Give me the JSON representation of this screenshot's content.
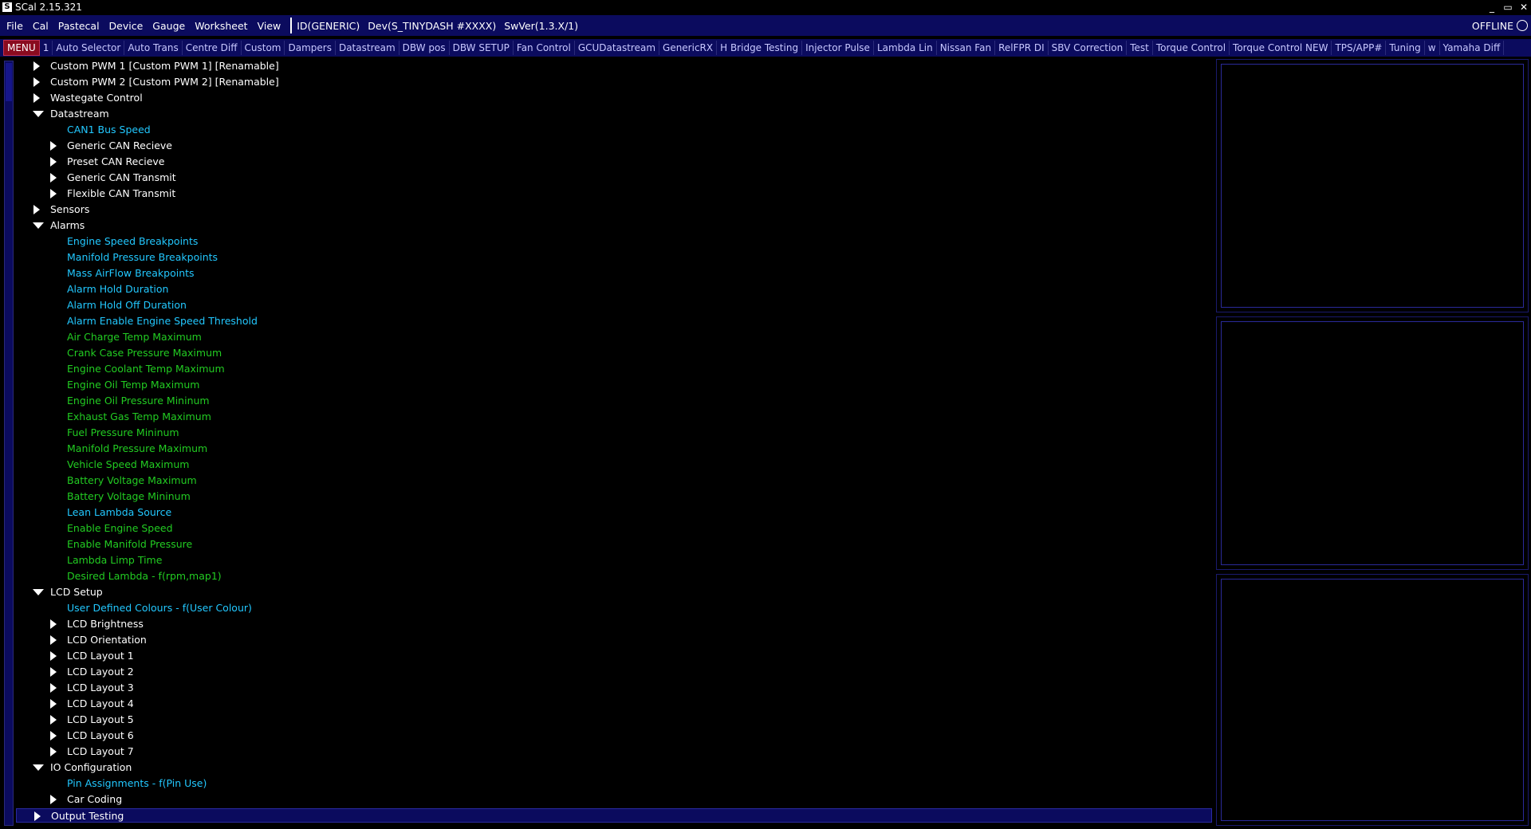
{
  "window": {
    "title": "SCal 2.15.321",
    "icon_letter": "S",
    "controls": [
      "_",
      "▭",
      "✕"
    ]
  },
  "menubar": {
    "items": [
      "File",
      "Cal",
      "Pastecal",
      "Device",
      "Gauge",
      "Worksheet",
      "View"
    ],
    "device_info": [
      "ID(GENERIC)",
      "Dev(S_TINYDASH #XXXX)",
      "SwVer(1.3.X/1)"
    ],
    "status": "OFFLINE"
  },
  "tabs": [
    "MENU",
    "1",
    "Auto Selector",
    "Auto Trans",
    "Centre Diff",
    "Custom",
    "Dampers",
    "Datastream",
    "DBW pos",
    "DBW SETUP",
    "Fan Control",
    "GCUDatastream",
    "GenericRX",
    "H Bridge Testing",
    "Injector Pulse",
    "Lambda Lin",
    "Nissan Fan",
    "RelFPR DI",
    "SBV Correction",
    "Test",
    "Torque Control",
    "Torque Control NEW",
    "TPS/APP#",
    "Tuning",
    "w",
    "Yamaha Diff"
  ],
  "tree": [
    {
      "label": "Custom PWM 1 [Custom PWM 1] [Renamable]",
      "level": 1,
      "expander": "right",
      "color": "white"
    },
    {
      "label": "Custom PWM 2 [Custom PWM 2] [Renamable]",
      "level": 1,
      "expander": "right",
      "color": "white"
    },
    {
      "label": "Wastegate Control",
      "level": 1,
      "expander": "right",
      "color": "white"
    },
    {
      "label": "Datastream",
      "level": 1,
      "expander": "down",
      "color": "white"
    },
    {
      "label": "CAN1 Bus Speed",
      "level": 2,
      "expander": "none",
      "color": "cyan"
    },
    {
      "label": "Generic CAN Recieve",
      "level": 2,
      "expander": "right",
      "color": "white"
    },
    {
      "label": "Preset CAN Recieve",
      "level": 2,
      "expander": "right",
      "color": "white"
    },
    {
      "label": "Generic CAN Transmit",
      "level": 2,
      "expander": "right",
      "color": "white"
    },
    {
      "label": "Flexible CAN Transmit",
      "level": 2,
      "expander": "right",
      "color": "white"
    },
    {
      "label": "Sensors",
      "level": 1,
      "expander": "right",
      "color": "white"
    },
    {
      "label": "Alarms",
      "level": 1,
      "expander": "down",
      "color": "white"
    },
    {
      "label": "Engine Speed Breakpoints",
      "level": 2,
      "expander": "none",
      "color": "cyan"
    },
    {
      "label": "Manifold Pressure Breakpoints",
      "level": 2,
      "expander": "none",
      "color": "cyan"
    },
    {
      "label": "Mass AirFlow Breakpoints",
      "level": 2,
      "expander": "none",
      "color": "cyan"
    },
    {
      "label": "Alarm Hold Duration",
      "level": 2,
      "expander": "none",
      "color": "cyan"
    },
    {
      "label": "Alarm Hold Off Duration",
      "level": 2,
      "expander": "none",
      "color": "cyan"
    },
    {
      "label": "Alarm Enable Engine Speed Threshold",
      "level": 2,
      "expander": "none",
      "color": "cyan"
    },
    {
      "label": "Air Charge Temp Maximum",
      "level": 2,
      "expander": "none",
      "color": "green"
    },
    {
      "label": "Crank Case Pressure Maximum",
      "level": 2,
      "expander": "none",
      "color": "green"
    },
    {
      "label": "Engine Coolant Temp Maximum",
      "level": 2,
      "expander": "none",
      "color": "green"
    },
    {
      "label": "Engine Oil Temp Maximum",
      "level": 2,
      "expander": "none",
      "color": "green"
    },
    {
      "label": "Engine Oil Pressure Mininum",
      "level": 2,
      "expander": "none",
      "color": "green"
    },
    {
      "label": "Exhaust Gas Temp Maximum",
      "level": 2,
      "expander": "none",
      "color": "green"
    },
    {
      "label": "Fuel Pressure Mininum",
      "level": 2,
      "expander": "none",
      "color": "green"
    },
    {
      "label": "Manifold Pressure Maximum",
      "level": 2,
      "expander": "none",
      "color": "green"
    },
    {
      "label": "Vehicle Speed Maximum",
      "level": 2,
      "expander": "none",
      "color": "green"
    },
    {
      "label": "Battery Voltage Maximum",
      "level": 2,
      "expander": "none",
      "color": "green"
    },
    {
      "label": "Battery Voltage Mininum",
      "level": 2,
      "expander": "none",
      "color": "green"
    },
    {
      "label": "Lean Lambda Source",
      "level": 2,
      "expander": "none",
      "color": "cyan"
    },
    {
      "label": "Enable Engine Speed",
      "level": 2,
      "expander": "none",
      "color": "green"
    },
    {
      "label": "Enable Manifold Pressure",
      "level": 2,
      "expander": "none",
      "color": "green"
    },
    {
      "label": "Lambda Limp Time",
      "level": 2,
      "expander": "none",
      "color": "green"
    },
    {
      "label": "Desired Lambda - f(rpm,map1)",
      "level": 2,
      "expander": "none",
      "color": "green"
    },
    {
      "label": "LCD Setup",
      "level": 1,
      "expander": "down",
      "color": "white"
    },
    {
      "label": "User Defined Colours - f(User Colour)",
      "level": 2,
      "expander": "none",
      "color": "cyan"
    },
    {
      "label": "LCD Brightness",
      "level": 2,
      "expander": "right",
      "color": "white"
    },
    {
      "label": "LCD Orientation",
      "level": 2,
      "expander": "right",
      "color": "white"
    },
    {
      "label": "LCD Layout 1",
      "level": 2,
      "expander": "right",
      "color": "white"
    },
    {
      "label": "LCD Layout 2",
      "level": 2,
      "expander": "right",
      "color": "white"
    },
    {
      "label": "LCD Layout 3",
      "level": 2,
      "expander": "right",
      "color": "white"
    },
    {
      "label": "LCD Layout 4",
      "level": 2,
      "expander": "right",
      "color": "white"
    },
    {
      "label": "LCD Layout 5",
      "level": 2,
      "expander": "right",
      "color": "white"
    },
    {
      "label": "LCD Layout 6",
      "level": 2,
      "expander": "right",
      "color": "white"
    },
    {
      "label": "LCD Layout 7",
      "level": 2,
      "expander": "right",
      "color": "white"
    },
    {
      "label": "IO Configuration",
      "level": 1,
      "expander": "down",
      "color": "white"
    },
    {
      "label": "Pin Assignments - f(Pin Use)",
      "level": 2,
      "expander": "none",
      "color": "cyan"
    },
    {
      "label": "Car Coding",
      "level": 2,
      "expander": "right",
      "color": "white"
    },
    {
      "label": "Output Testing",
      "level": 1,
      "expander": "right",
      "color": "white",
      "selected": true
    }
  ],
  "colors": {
    "bar_bg": "#0b0b5e",
    "menu_tab_bg": "#8a0b1f",
    "cyan_item": "#22c8ff",
    "green_item": "#22cc22"
  }
}
